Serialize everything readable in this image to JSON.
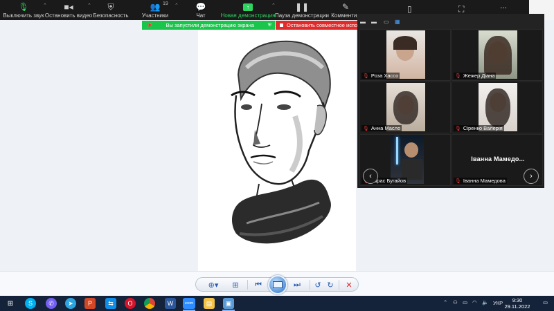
{
  "toolbar": {
    "mute_label": "Выключить звук",
    "video_label": "Остановить видео",
    "security_label": "Безопасность",
    "participants_label": "Участники",
    "participants_count": "19",
    "chat_label": "Чат",
    "new_share_label": "Новая демонстрация",
    "pause_share_label": "Пауза демонстрации",
    "annotate_label": "Комментир",
    "more_label": "..."
  },
  "banner": {
    "sharing_text": "Вы запустили демонстрацию экрана",
    "stop_text": "Остановить совместное испол"
  },
  "gallery": {
    "tiles": [
      {
        "name": "Роза Хассо",
        "video_color": "#c9a58e"
      },
      {
        "name": "Жежер Діана",
        "video_color": "#6b5a4d"
      },
      {
        "name": "Анна Масло",
        "video_color": "#8a7f74"
      },
      {
        "name": "Сіренко Валерія",
        "video_color": "#9a8e86"
      },
      {
        "name": "Тарас Бугайов",
        "video_color": "#22242a"
      },
      {
        "name": "Іванна Мамедова",
        "big_name": "Іванна  Мамедо..."
      }
    ]
  },
  "taskbar": {
    "lang": "УКР",
    "time": "9:30",
    "date": "29.11.2022"
  },
  "colors": {
    "toolbar_bg": "#1a1a1a",
    "share_green": "#19c64b",
    "stop_red": "#e02b2b",
    "taskbar_bg": "#15233a"
  }
}
